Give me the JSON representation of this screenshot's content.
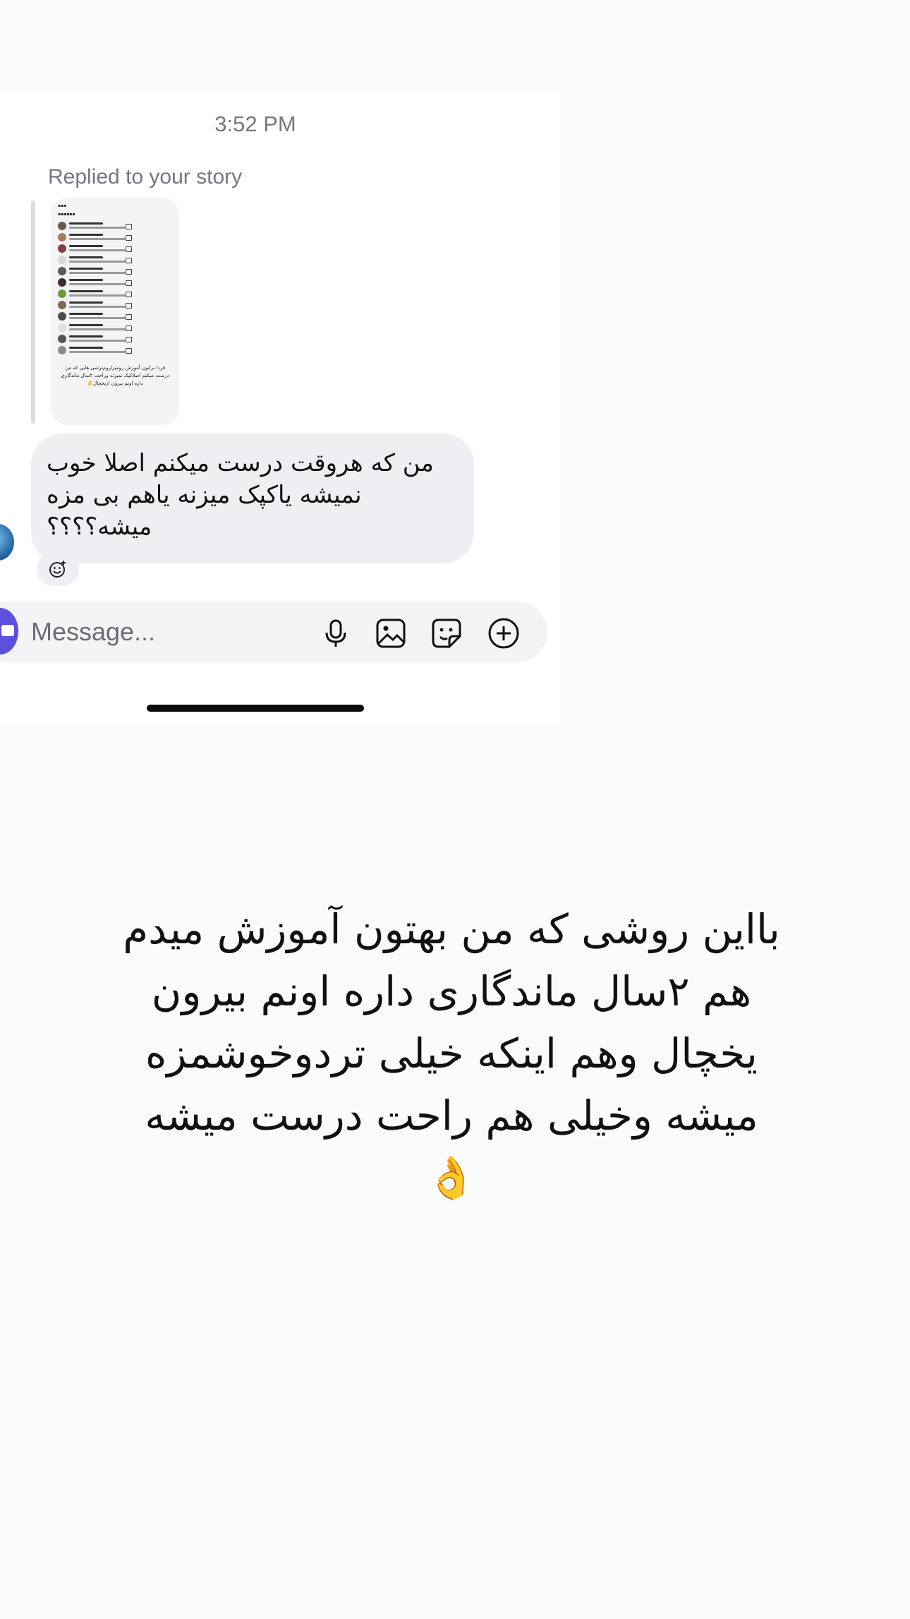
{
  "conversation": {
    "timestamp": "3:52 PM",
    "reply_label": "Replied to your story",
    "story_preview": {
      "caption": "فردا براتون آموزش رومیزاروم‌ترشی هایی که من درست میکنم اصلاکپک نمیزنه وراحت ۲سال ماندگاری داره اونم بیرون ازیخچال👌"
    },
    "message": "من که هروقت درست میکنم اصلا خوب نمیشه یاکپک میزنه یاهم بی مزه میشه؟؟؟؟"
  },
  "composer": {
    "placeholder": "Message...",
    "icons": [
      "camera-icon",
      "microphone-icon",
      "gallery-icon",
      "sticker-icon",
      "add-icon"
    ]
  },
  "story_caption": "بااین روشی که من بهتون آموزش میدم هم ۲سال ماندگاری داره اونم بیرون یخچال وهم اینکه خیلی تردوخوشمزه میشه وخیلی هم راحت درست میشه👌",
  "colors": {
    "accent": "#5b51de",
    "bubble": "#efeff3",
    "muted_text": "#737780",
    "background": "#fbfbfb"
  }
}
